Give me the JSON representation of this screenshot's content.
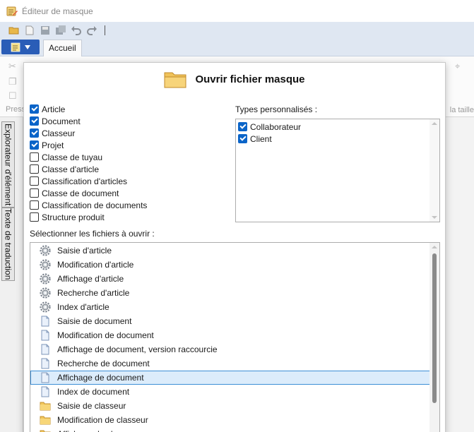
{
  "window": {
    "title": "Éditeur de masque",
    "icon": "mask-editor-icon"
  },
  "ribbon": {
    "home_tab": "Accueil",
    "left_fragment": "Press",
    "right_fragment": "la taille"
  },
  "side_tabs": [
    "Explorateur d'élément",
    "Texte de traduction"
  ],
  "dialog": {
    "title": "Ouvrir fichier masque",
    "object_types": [
      {
        "label": "Article",
        "checked": true
      },
      {
        "label": "Document",
        "checked": true
      },
      {
        "label": "Classeur",
        "checked": true
      },
      {
        "label": "Projet",
        "checked": true
      },
      {
        "label": "Classe de tuyau",
        "checked": false
      },
      {
        "label": "Classe d'article",
        "checked": false
      },
      {
        "label": "Classification d'articles",
        "checked": false
      },
      {
        "label": "Classe de document",
        "checked": false
      },
      {
        "label": "Classification de documents",
        "checked": false
      },
      {
        "label": "Structure produit",
        "checked": false
      }
    ],
    "custom_types_label": "Types personnalisés :",
    "custom_types": [
      {
        "label": "Collaborateur",
        "checked": true
      },
      {
        "label": "Client",
        "checked": true
      }
    ],
    "files_label": "Sélectionner les fichiers à ouvrir :",
    "files": [
      {
        "label": "Saisie d'article",
        "icon": "gear-icon"
      },
      {
        "label": "Modification d'article",
        "icon": "gear-icon"
      },
      {
        "label": "Affichage d'article",
        "icon": "gear-icon"
      },
      {
        "label": "Recherche d'article",
        "icon": "gear-icon"
      },
      {
        "label": "Index d'article",
        "icon": "gear-icon"
      },
      {
        "label": "Saisie de document",
        "icon": "document-icon"
      },
      {
        "label": "Modification de document",
        "icon": "document-icon"
      },
      {
        "label": "Affichage de document, version raccourcie",
        "icon": "document-icon"
      },
      {
        "label": "Recherche de document",
        "icon": "document-icon"
      },
      {
        "label": "Affichage de document",
        "icon": "document-icon",
        "selected": true
      },
      {
        "label": "Index de document",
        "icon": "document-icon"
      },
      {
        "label": "Saisie de classeur",
        "icon": "folder-icon"
      },
      {
        "label": "Modification de classeur",
        "icon": "folder-icon"
      },
      {
        "label": "Affichage de classeur",
        "icon": "folder-icon"
      }
    ]
  }
}
